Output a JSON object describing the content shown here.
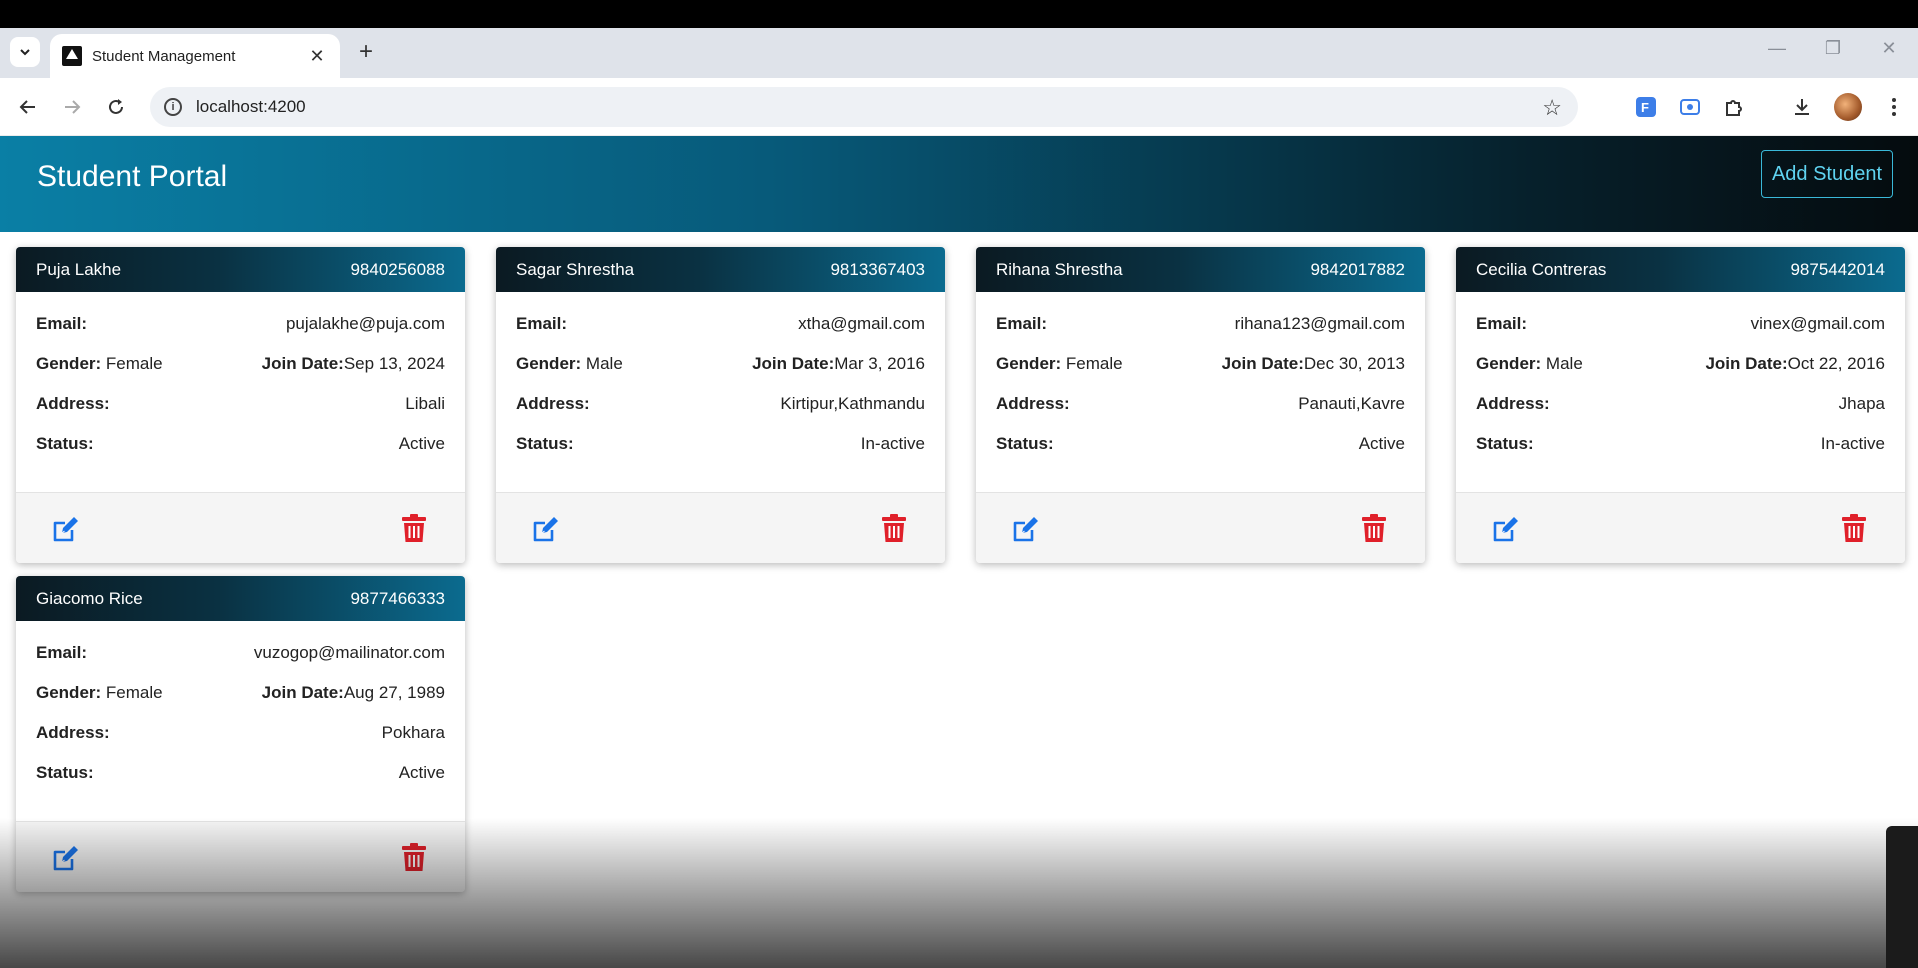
{
  "browser": {
    "tab_title": "Student Management",
    "url": "localhost:4200"
  },
  "header": {
    "title": "Student Portal",
    "add_button": "Add Student"
  },
  "labels": {
    "email": "Email:",
    "gender": "Gender:",
    "join_date": "Join Date:",
    "address": "Address:",
    "status": "Status:"
  },
  "students": [
    {
      "name": "Puja Lakhe",
      "phone": "9840256088",
      "email": "pujalakhe@puja.com",
      "gender": "Female",
      "join_date": "Sep 13, 2024",
      "address": "Libali",
      "status": "Active"
    },
    {
      "name": "Sagar Shrestha",
      "phone": "9813367403",
      "email": "xtha@gmail.com",
      "gender": "Male",
      "join_date": "Mar 3, 2016",
      "address": "Kirtipur,Kathmandu",
      "status": "In-active"
    },
    {
      "name": "Rihana Shrestha",
      "phone": "9842017882",
      "email": "rihana123@gmail.com",
      "gender": "Female",
      "join_date": "Dec 30, 2013",
      "address": "Panauti,Kavre",
      "status": "Active"
    },
    {
      "name": "Cecilia Contreras",
      "phone": "9875442014",
      "email": "vinex@gmail.com",
      "gender": "Male",
      "join_date": "Oct 22, 2016",
      "address": "Jhapa",
      "status": "In-active"
    },
    {
      "name": "Giacomo Rice",
      "phone": "9877466333",
      "email": "vuzogop@mailinator.com",
      "gender": "Female",
      "join_date": "Aug 27, 1989",
      "address": "Pokhara",
      "status": "Active"
    }
  ],
  "icons": {
    "edit": "edit-icon",
    "delete": "trash-icon"
  },
  "colors": {
    "edit": "#1a73e8",
    "delete": "#e0202a",
    "add_button": "#5fd3f0"
  }
}
